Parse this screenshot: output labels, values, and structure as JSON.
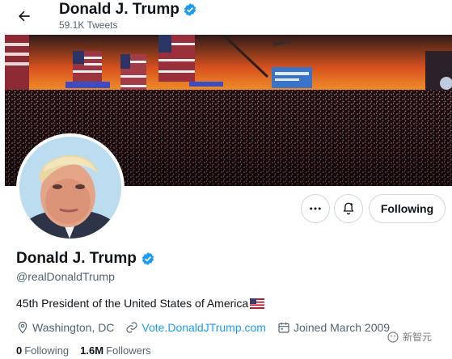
{
  "header": {
    "title": "Donald J. Trump",
    "tweet_count": "59.1K Tweets"
  },
  "profile": {
    "name": "Donald J. Trump",
    "handle": "@realDonaldTrump",
    "bio": "45th President of the United States of America",
    "bio_emoji": "flag-us-icon",
    "location": "Washington, DC",
    "website": "Vote.DonaldJTrump.com",
    "joined": "Joined March 2009",
    "following_count": "0",
    "following_label": "Following",
    "followers_count": "1.6M",
    "followers_label": "Followers"
  },
  "actions": {
    "more_icon": "more-icon",
    "notify_icon": "notification-bell-icon",
    "follow_label": "Following"
  },
  "watermark": {
    "text": "新智元"
  },
  "colors": {
    "accent": "#1d9bf0",
    "secondary_text": "#536471",
    "primary_text": "#0f1419"
  }
}
